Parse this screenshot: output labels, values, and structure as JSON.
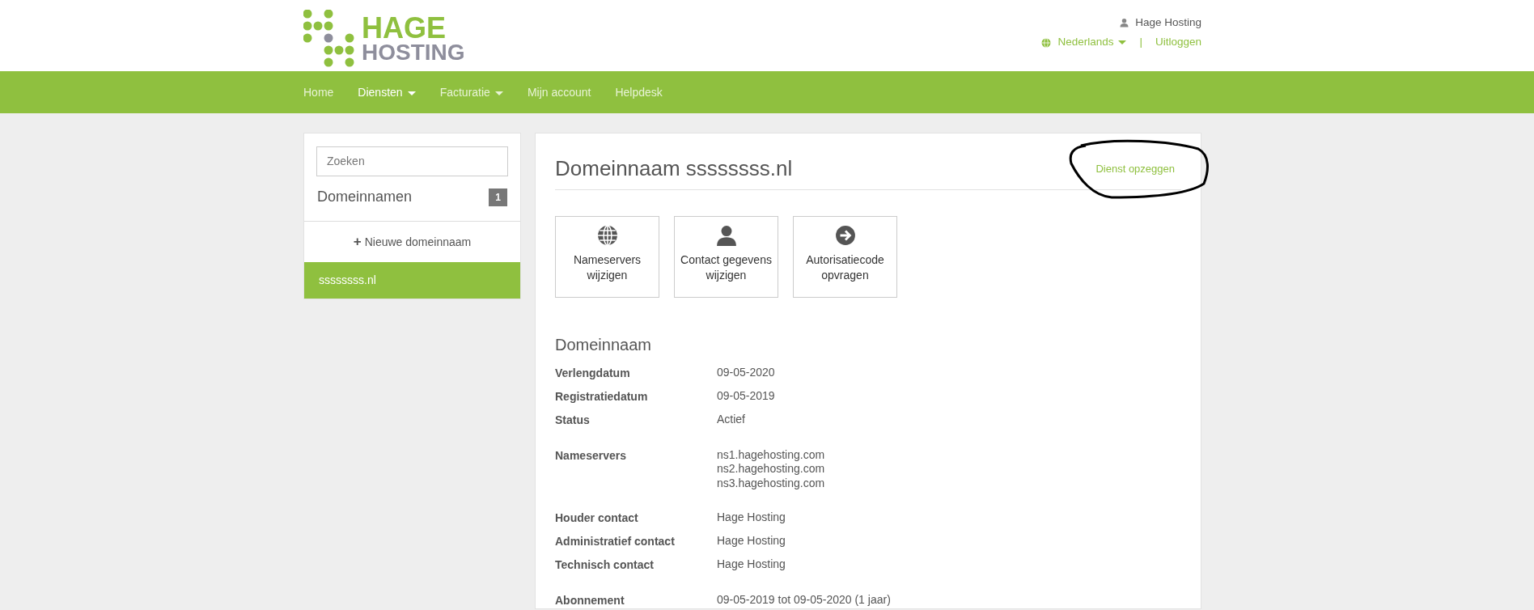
{
  "header": {
    "logo": {
      "line_1": "HAGE",
      "line_2": "HOSTING"
    },
    "user": "Hage Hosting",
    "language": "Nederlands",
    "separator": "|",
    "logout": "Uitloggen"
  },
  "navbar": {
    "items": [
      {
        "label": "Home",
        "selected": false,
        "dropdown": false
      },
      {
        "label": "Diensten",
        "selected": true,
        "dropdown": true
      },
      {
        "label": "Facturatie",
        "selected": false,
        "dropdown": true
      },
      {
        "label": "Mijn account",
        "selected": false,
        "dropdown": false
      },
      {
        "label": "Helpdesk",
        "selected": false,
        "dropdown": false
      }
    ]
  },
  "sidebar": {
    "search": {
      "placeholder": "Zoeken"
    },
    "title": "Domeinnamen",
    "count": "1",
    "add_label": "Nieuwe domeinnaam",
    "add_icon": "+",
    "items": [
      {
        "label": "ssssssss.nl",
        "selected": true
      }
    ]
  },
  "main": {
    "title": "Domeinnaam ssssssss.nl",
    "cancel_link": "Dienst opzeggen",
    "actions": [
      {
        "kind": "globe",
        "label": "Nameservers wijzigen"
      },
      {
        "kind": "person",
        "label": "Contact gegevens wijzigen"
      },
      {
        "kind": "arrow",
        "label": "Autorisatiecode opvragen"
      }
    ],
    "section_title": "Domeinnaam",
    "groups": [
      [
        {
          "label": "Verlengdatum",
          "values": [
            "09-05-2020"
          ]
        },
        {
          "label": "Registratiedatum",
          "values": [
            "09-05-2019"
          ]
        },
        {
          "label": "Status",
          "values": [
            "Actief"
          ]
        }
      ],
      [
        {
          "label": "Nameservers",
          "values": [
            "ns1.hagehosting.com",
            "ns2.hagehosting.com",
            "ns3.hagehosting.com"
          ]
        }
      ],
      [
        {
          "label": "Houder contact",
          "values": [
            "Hage Hosting"
          ]
        },
        {
          "label": "Administratief contact",
          "values": [
            "Hage Hosting"
          ]
        },
        {
          "label": "Technisch contact",
          "values": [
            "Hage Hosting"
          ]
        }
      ],
      [
        {
          "label": "Abonnement",
          "values": [
            "09-05-2019 tot 09-05-2020 (1 jaar)"
          ]
        }
      ]
    ]
  }
}
